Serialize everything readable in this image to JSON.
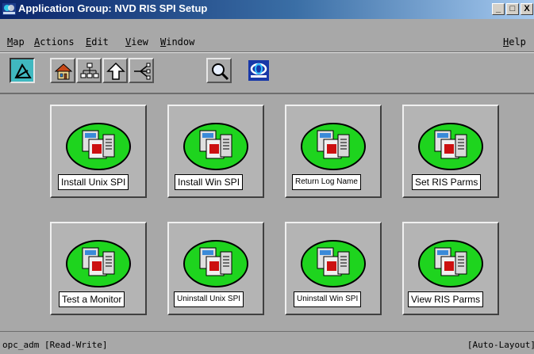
{
  "window": {
    "title": "Application Group: NVD RIS SPI Setup",
    "controls": {
      "minimize": "_",
      "maximize": "□",
      "close": "X"
    },
    "app_icon": "ovw-logo-icon"
  },
  "menubar": {
    "items": [
      {
        "label": "Map",
        "underline_index": 0
      },
      {
        "label": "Actions",
        "underline_index": 0
      },
      {
        "label": "Edit",
        "underline_index": 0
      },
      {
        "label": "View",
        "underline_index": 0
      },
      {
        "label": "Window",
        "underline_index": 0
      },
      {
        "label": "Help",
        "underline_index": 0
      }
    ]
  },
  "toolbar": {
    "buttons": [
      {
        "icon": "select-mode-icon",
        "pressed": true
      },
      {
        "icon": "home-icon",
        "pressed": false
      },
      {
        "icon": "hierarchy-tree-icon",
        "pressed": false
      },
      {
        "icon": "up-arrow-icon",
        "pressed": false
      },
      {
        "icon": "network-fan-icon",
        "pressed": false
      },
      {
        "icon": "magnifier-icon",
        "pressed": false
      },
      {
        "icon": "nnm-logo-icon",
        "pressed": false
      }
    ]
  },
  "applications": [
    {
      "label": "Install Unix SPI"
    },
    {
      "label": "Install Win SPI"
    },
    {
      "label": "Return Log Name"
    },
    {
      "label": "Set RIS Parms"
    },
    {
      "label": "Test a Monitor"
    },
    {
      "label": "Uninstall Unix SPI"
    },
    {
      "label": "Uninstall Win SPI"
    },
    {
      "label": "View RIS Parms"
    }
  ],
  "status": {
    "left": "opc_adm [Read-Write]",
    "right": "[Auto-Layout]"
  },
  "colors": {
    "title_gradient_start": "#0a246a",
    "window_background": "#a8a8a8",
    "app_icon_ellipse": "#1ed41e",
    "pressed_tool": "#40b8c0"
  }
}
